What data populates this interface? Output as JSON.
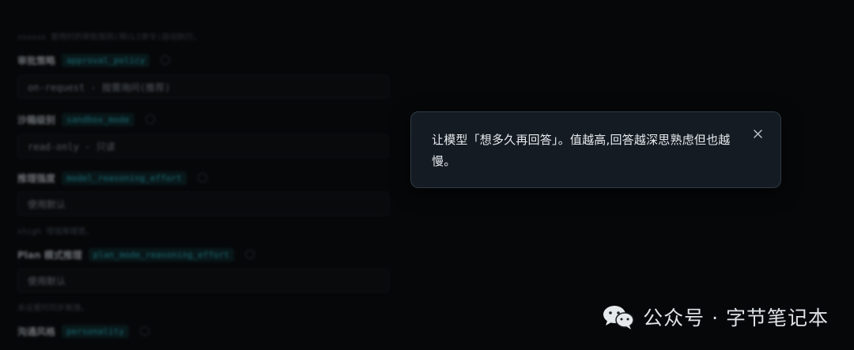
{
  "background_form": {
    "top_hint": "xxxxxx 使用时的审批规则(将CLI命令)自动执行。",
    "fields": [
      {
        "title": "审批策略",
        "key": "approval_policy",
        "value": "on-request - 按需询问(推荐)"
      },
      {
        "title": "沙箱级别",
        "key": "sandbox_mode",
        "value": "read-only - 只读"
      },
      {
        "title": "推理强度",
        "key": "model_reasoning_effort",
        "value": "使用默认"
      },
      {
        "title": "Plan 模式推理",
        "key": "plan_mode_reasoning_effort",
        "value": "使用默认"
      },
      {
        "title": "沟通风格",
        "key": "personality",
        "value": ""
      }
    ],
    "hints": [
      "xhigh 增强推理度。",
      "未设置时同步推理。"
    ]
  },
  "tooltip": {
    "text": "让模型「想多久再回答」。值越高,回答越深思熟虑但也越慢。",
    "close_icon": "close-icon"
  },
  "watermark": {
    "text": "公众号 · 字节笔记本",
    "icon": "wechat-icon"
  }
}
